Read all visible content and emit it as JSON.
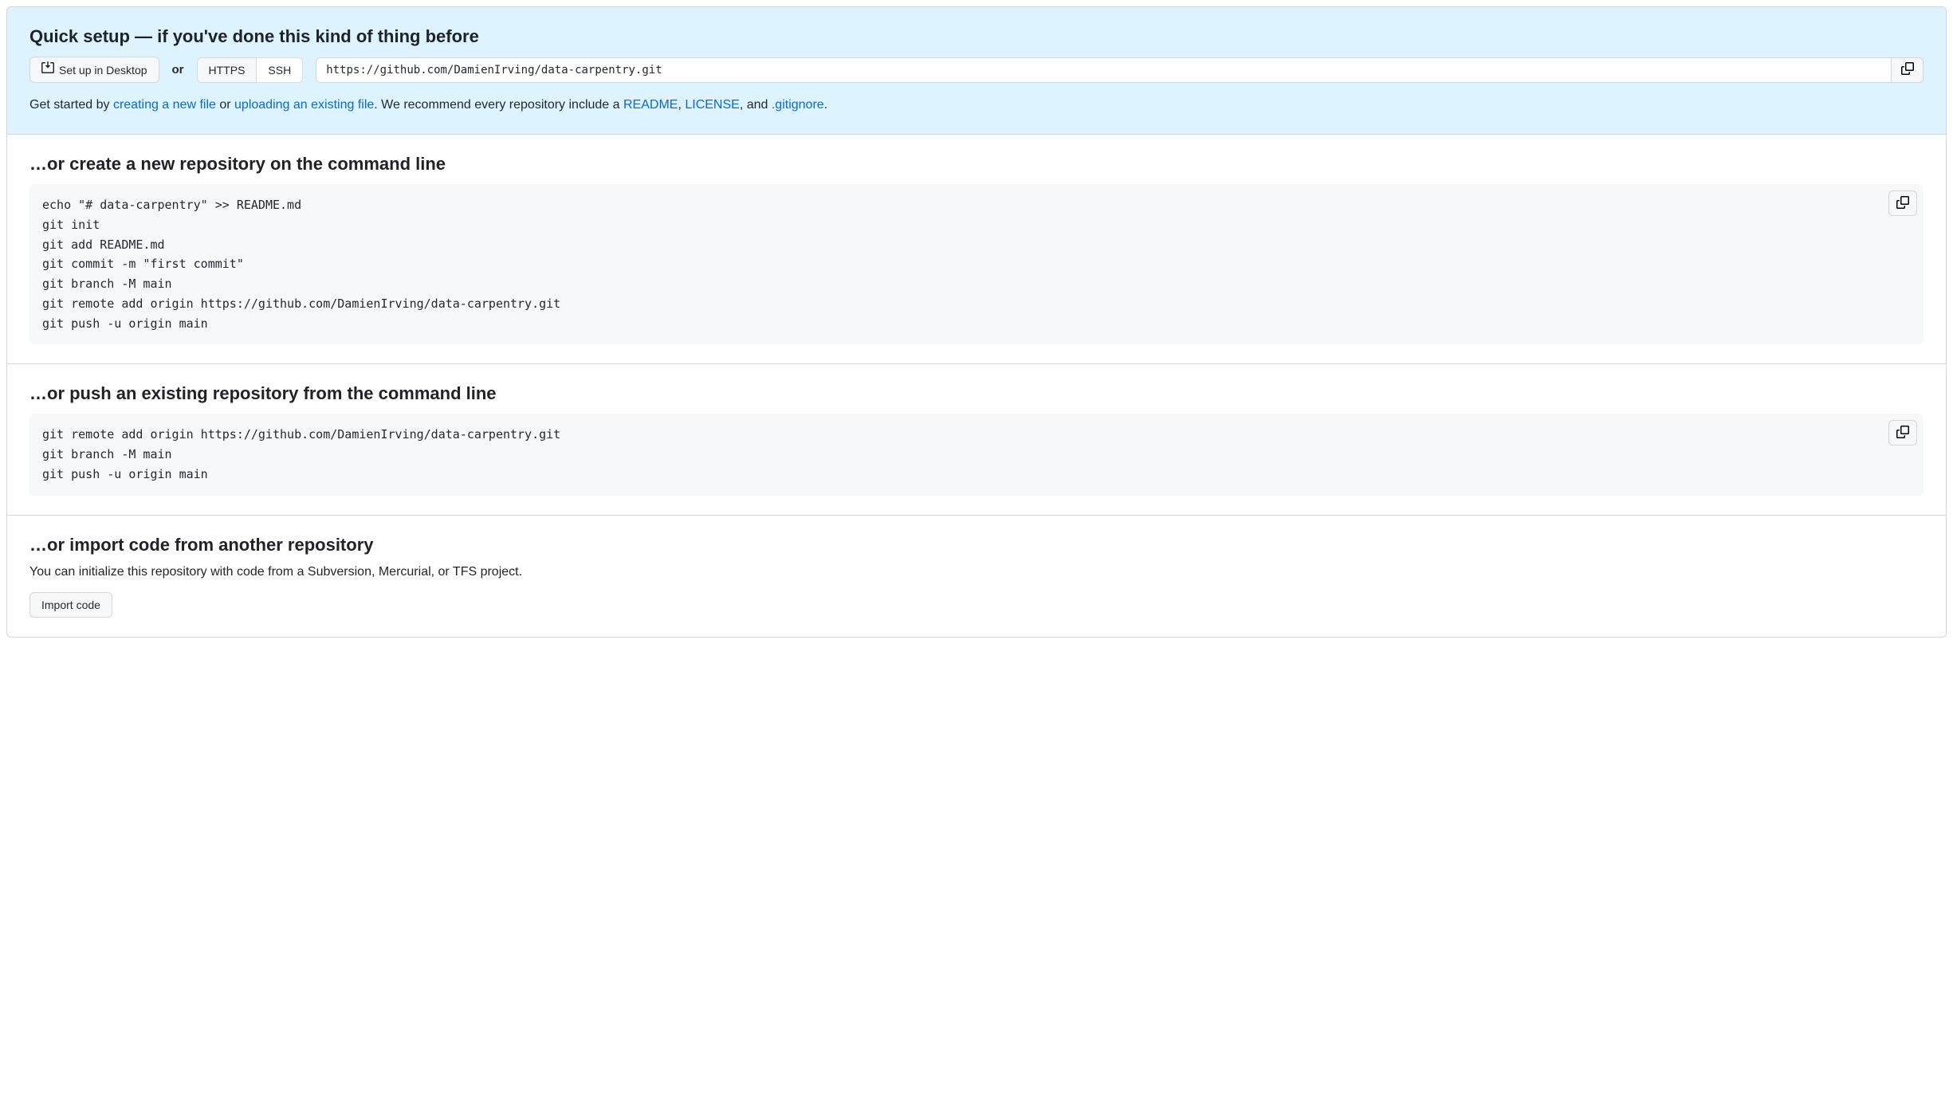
{
  "quickSetup": {
    "heading": "Quick setup — if you've done this kind of thing before",
    "desktopBtn": "Set up in Desktop",
    "or": "or",
    "httpsBtn": "HTTPS",
    "sshBtn": "SSH",
    "cloneUrl": "https://github.com/DamienIrving/data-carpentry.git",
    "help": {
      "prefix": "Get started by ",
      "createFile": "creating a new file",
      "or": " or ",
      "uploadFile": "uploading an existing file",
      "middle": ". We recommend every repository include a ",
      "readme": "README",
      "comma": ", ",
      "license": "LICENSE",
      "and": ", and ",
      "gitignore": ".gitignore",
      "end": "."
    }
  },
  "createRepo": {
    "heading": "…or create a new repository on the command line",
    "code": "echo \"# data-carpentry\" >> README.md\ngit init\ngit add README.md\ngit commit -m \"first commit\"\ngit branch -M main\ngit remote add origin https://github.com/DamienIrving/data-carpentry.git\ngit push -u origin main"
  },
  "pushExisting": {
    "heading": "…or push an existing repository from the command line",
    "code": "git remote add origin https://github.com/DamienIrving/data-carpentry.git\ngit branch -M main\ngit push -u origin main"
  },
  "importCode": {
    "heading": "…or import code from another repository",
    "subtext": "You can initialize this repository with code from a Subversion, Mercurial, or TFS project.",
    "button": "Import code"
  }
}
